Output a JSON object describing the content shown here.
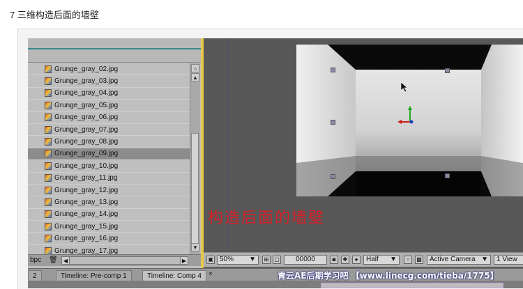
{
  "heading": "7 三维构造后面的墙壁",
  "project": {
    "files": [
      "Grunge_gray_02.jpg",
      "Grunge_gray_03.jpg",
      "Grunge_gray_04.jpg",
      "Grunge_gray_05.jpg",
      "Grunge_gray_06.jpg",
      "Grunge_gray_07.jpg",
      "Grunge_gray_08.jpg",
      "Grunge_gray_09.jpg",
      "Grunge_gray_10.jpg",
      "Grunge_gray_11.jpg",
      "Grunge_gray_12.jpg",
      "Grunge_gray_13.jpg",
      "Grunge_gray_14.jpg",
      "Grunge_gray_15.jpg",
      "Grunge_gray_16.jpg",
      "Grunge_gray_17.jpg"
    ],
    "selected": "Grunge_gray_09.jpg",
    "bpc_label": "bpc"
  },
  "viewer": {
    "caption": "构造后面的墙壁",
    "zoom": "50%",
    "timecode": "00000",
    "resolution": "Half",
    "camera": "Active Camera",
    "view_layout": "1 View"
  },
  "timeline": {
    "tabs": [
      "2",
      "Timeline: Pre-comp 1",
      "Timeline: Comp 4"
    ],
    "active_tab": "Timeline: Comp 4",
    "close_glyph": "×"
  },
  "watermark": "青云AE后期学习吧 【www.linecg.com/tieba/1775】",
  "colors": {
    "panel_divider": "#e8c84a",
    "caption": "#d4202a",
    "selected_row": "#8c8c8c"
  }
}
